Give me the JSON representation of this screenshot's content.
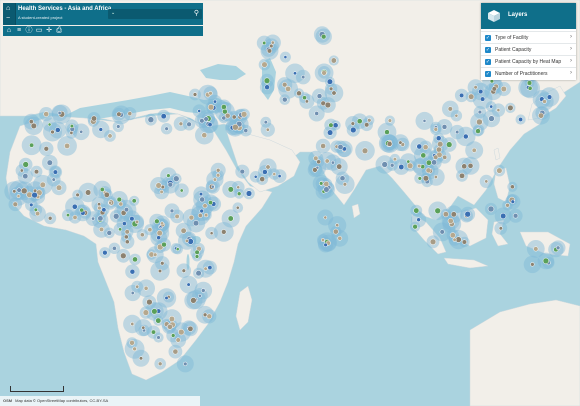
{
  "app": {
    "title": "Health Services - Asia and Africa",
    "subtitle": "A student-created project"
  },
  "search": {
    "placeholder": ""
  },
  "toolbar": {
    "tools": [
      "home-icon",
      "layers-icon",
      "info-icon",
      "measure-icon",
      "locate-icon",
      "print-icon"
    ]
  },
  "layers": {
    "title": "Layers",
    "items": [
      {
        "label": "Type of Facility",
        "checked": true
      },
      {
        "label": "Patient Capacity",
        "checked": true
      },
      {
        "label": "Patient Capacity by Heat Map",
        "checked": true
      },
      {
        "label": "Number of Practitioners",
        "checked": true
      }
    ]
  },
  "map": {
    "colors": {
      "water": "#aad3df",
      "land": "#f2efe9",
      "halo": "#7fb7d6",
      "marker": "#9a8f7a"
    }
  },
  "attribution": {
    "prefix": "OSM",
    "text": "Map data © OpenStreetMap contributors, CC-BY-SA"
  }
}
